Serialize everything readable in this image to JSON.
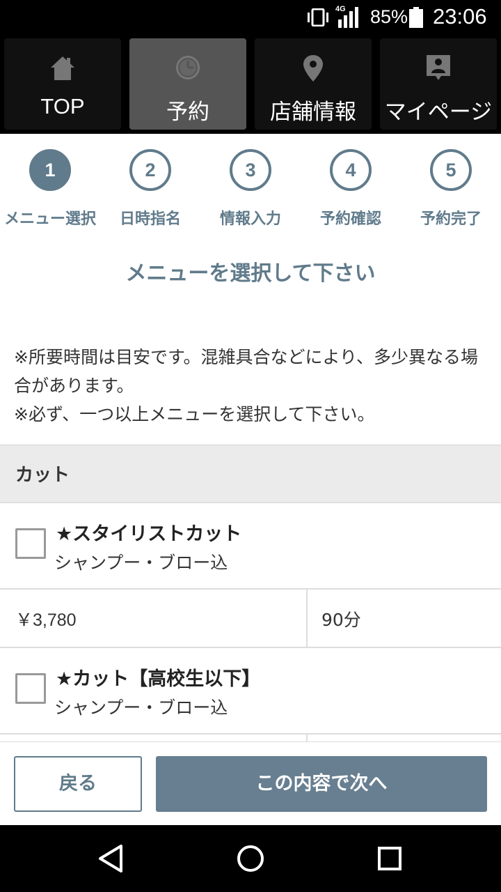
{
  "status_bar": {
    "network": "4G",
    "battery": "85%",
    "time": "23:06"
  },
  "nav": {
    "tabs": [
      {
        "label": "TOP",
        "icon": "home-icon"
      },
      {
        "label": "予約",
        "icon": "clock-icon",
        "active": true
      },
      {
        "label": "店舗情報",
        "icon": "map-pin-icon"
      },
      {
        "label": "マイページ",
        "icon": "user-card-icon"
      }
    ]
  },
  "steps": [
    {
      "number": "1",
      "label": "メニュー選択",
      "active": true
    },
    {
      "number": "2",
      "label": "日時指名"
    },
    {
      "number": "3",
      "label": "情報入力"
    },
    {
      "number": "4",
      "label": "予約確認"
    },
    {
      "number": "5",
      "label": "予約完了"
    }
  ],
  "section_title": "メニューを選択して下さい",
  "notes": {
    "line1": "※所要時間は目安です。混雑具合などにより、多少異なる場合があります。",
    "line2": "※必ず、一つ以上メニューを選択して下さい。"
  },
  "category": {
    "name": "カット"
  },
  "menu_items": [
    {
      "name": "★スタイリストカット",
      "description": "シャンプー・ブロー込",
      "price": "￥3,780",
      "duration": "90分"
    },
    {
      "name": "★カット【高校生以下】",
      "description": "シャンプー・ブロー込"
    }
  ],
  "actions": {
    "back_label": "戻る",
    "next_label": "この内容で次へ"
  },
  "colors": {
    "accent": "#607b8b",
    "next_button": "#677f90",
    "category_bg": "#ebebeb"
  }
}
